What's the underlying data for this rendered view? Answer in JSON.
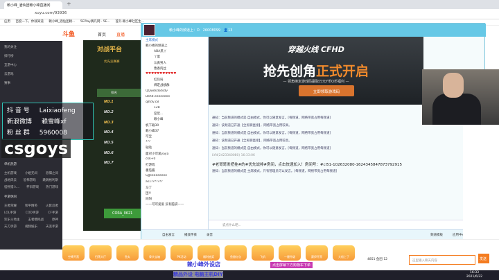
{
  "browser": {
    "tab_title": "赖小峰_酒仙团赖小峰直播间",
    "url": "xuyu.com/93936",
    "bookmarks": [
      "应用",
      "百度一下，你就知道",
      "赖小峰_酒仙团赖...",
      "5EPlay赛凡网 · 5E...",
      "首页-赖小峰社区生..."
    ]
  },
  "douyu": {
    "logo": "斗鱼",
    "nav": [
      "首页",
      "直播"
    ],
    "sidebar": [
      "我的关注",
      "排行榜",
      "互游中心",
      "云游戏",
      "赛事"
    ],
    "sections": [
      {
        "title": "单机热游",
        "items": [
          "主机游戏",
          "小姐无间",
          "恐惧之间",
          "战地风云",
          "恐怖游戏",
          "跳跳格利斯",
          "怪物猎人...",
          "怀旧游戏",
          "热门游戏"
        ]
      },
      {
        "title": "手游休闲",
        "items": [
          "王者荣耀",
          "和平精英",
          "火影忍者",
          "LOL手游",
          "COD手游",
          "CF手游",
          "欢乐斗地主",
          "王者模拟战",
          "原神",
          "天刀手游",
          "视频娱乐",
          "天涯手游"
        ]
      }
    ],
    "gifts": [
      "空降开黑",
      "扫荡大厅",
      "鱼丸",
      "骨头宝箱",
      "PK活动",
      "福利抽奖",
      "鱼翅红包",
      "飞机",
      "一键升级",
      "赛伊开黑",
      "大船上了"
    ],
    "chat_input_placeholder": "这里输入聊天内容",
    "send_label": "发送",
    "room_stats": "4851",
    "fans_label": "鱼团 12"
  },
  "overlay": {
    "rows": [
      {
        "label": "抖 音 号",
        "value": "Laixiaofeng"
      },
      {
        "label": "新浪微博",
        "value": "赖雪峰xf"
      },
      {
        "label": "粉 丝 群",
        "value": "5960008"
      }
    ],
    "brand": "csgoys"
  },
  "e5": {
    "title": "对战平台",
    "tab": "优先竞赛赛",
    "header": "排名",
    "ranks": [
      "NO.1",
      "NO.2",
      "NO.3",
      "NO.4",
      "NO.5",
      "NO.6",
      "NO.7"
    ],
    "player": "CORA_0621"
  },
  "yy": {
    "title": "赖小峰的频道上：D",
    "id": "26008099",
    "online": "13",
    "mode": "主席模式",
    "channels": [
      {
        "name": "赖小峰的频道上",
        "sub": false
      },
      {
        "name": "ABA黑丫",
        "sub": true
      },
      {
        "name": "丫蛋",
        "sub": true
      },
      {
        "name": "认真男人",
        "sub": true
      },
      {
        "name": "鲁香肉丝",
        "sub": true
      },
      {
        "name": "♥♥♥♥♥♥♥♥♥♥♥",
        "sub": false
      },
      {
        "name": "红包局",
        "sub": true
      },
      {
        "name": "绑定战绩群",
        "sub": true
      },
      {
        "name": "QQwdsdsdsdv",
        "sub": false
      },
      {
        "name": "Dshd.eeeeeeee",
        "sub": false
      },
      {
        "name": "qlltdv.c8",
        "sub": false
      },
      {
        "name": "128",
        "sub": true
      },
      {
        "name": "空足...",
        "sub": true
      },
      {
        "name": "赖小峰",
        "sub": true
      },
      {
        "name": "帆下载30",
        "sub": false
      },
      {
        "name": "赖小峰37",
        "sub": false
      },
      {
        "name": "可宝",
        "sub": false
      },
      {
        "name": "???",
        "sub": false
      },
      {
        "name": "哒哒",
        "sub": false
      },
      {
        "name": "面对小可爱yaya",
        "sub": false
      },
      {
        "name": "ckk+0",
        "sub": false
      },
      {
        "name": "打游戏",
        "sub": false
      },
      {
        "name": "番茄酱",
        "sub": false
      },
      {
        "name": "GJJeeeeeeeee",
        "sub": false
      },
      {
        "name": "as1???????",
        "sub": false
      },
      {
        "name": "马丁",
        "sub": false
      },
      {
        "name": "团!!",
        "sub": false
      },
      {
        "name": "向阳",
        "sub": false
      },
      {
        "name": "——可可爱爱 没有脑袋——",
        "sub": false
      }
    ],
    "banner": {
      "logo": "穿越火线 CFHD",
      "title_white": "抢先创角",
      "title_orange": "正式开启",
      "subtitle": "— 领角绑定游戏码赢取万元Y币Q币福利 —",
      "button": "立即领取游戏码"
    },
    "messages": [
      "通知：当前频道的模式是 自由模式，你可以随意发言。[每频道，网络带宽占用每频道]",
      "通知：该频道已开通【全民聊直接】，网络带宽占用较高。",
      "通知：当前频道的模式是 自由模式，你可以随意发言。[每频道，网络带宽占用每频道]",
      "通知：该频道已开通【全民聊直接】，网络带宽占用较高。",
      "通知：当前频道的模式是 自由模式，你可以随意发言。[每频道，网络带宽占用每频道]"
    ],
    "user_msg": {
      "user": "LYN(2423340080)",
      "time": "16:33:06",
      "text": "#老哥哥发把挂#的#优先战排#房间，点击快速加入！房间号：#cl51-102632080-1624345847873792915"
    },
    "last_msg": "通知：当前频道的模式是 主席模式，只有管理员可以发言。[每频道，网络带宽占用每频道]",
    "input_placeholder": "说点什么吧...",
    "toolbar": [
      "自由发言",
      "播放伴奏",
      "录音",
      "频道模板",
      "应用中心"
    ]
  },
  "taskbar": {
    "time": "16:33",
    "date": "2021/6/22",
    "promo1": "赖小峰外设店",
    "promo2": "精品外设 电脑主机DIY",
    "promo3": "点击屏幕下方购物车下单"
  }
}
